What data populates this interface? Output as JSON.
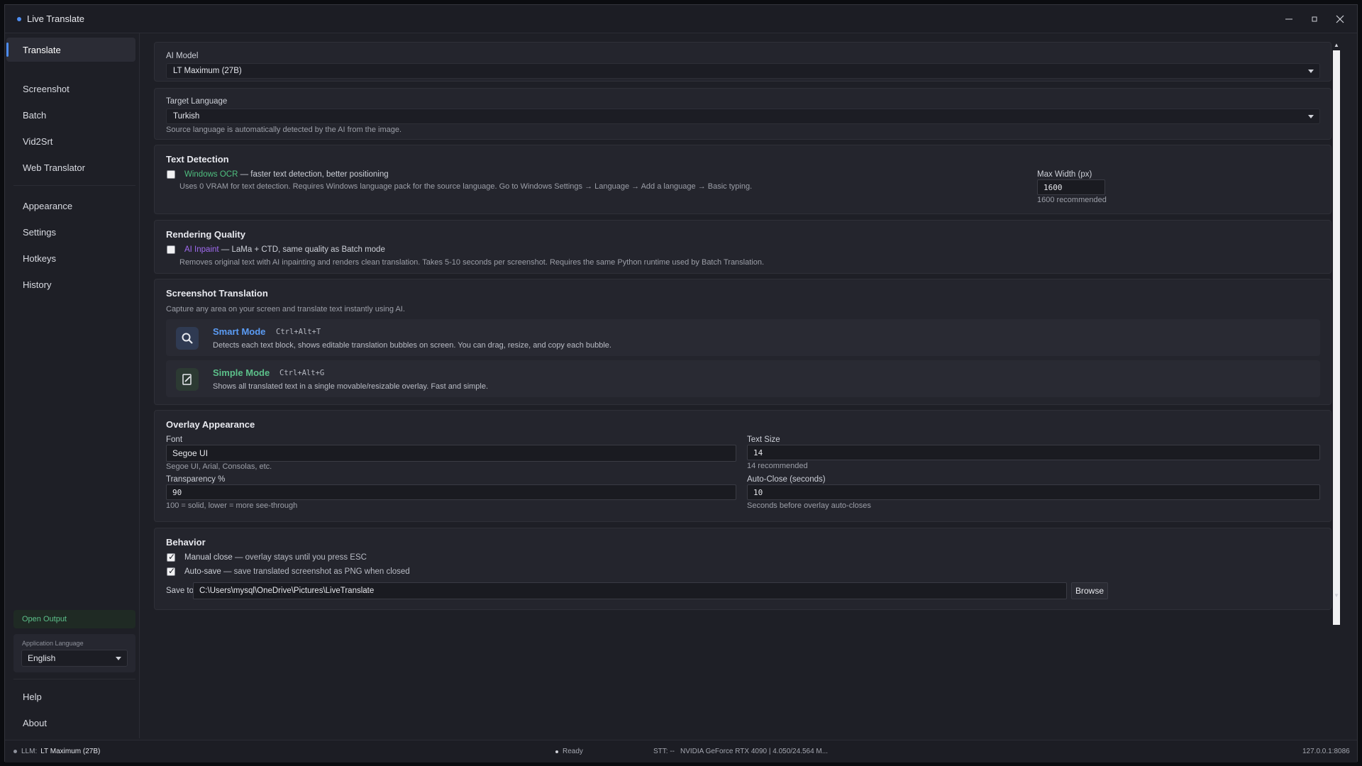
{
  "window": {
    "title": "Live Translate",
    "controls": [
      "—",
      "▫",
      "✕"
    ]
  },
  "sidebar": {
    "items": [
      {
        "label": "Translate"
      },
      {
        "label": "Screenshot"
      },
      {
        "label": "Batch"
      },
      {
        "label": "Vid2Srt"
      },
      {
        "label": "Web Translator"
      },
      {
        "label": "Appearance"
      },
      {
        "label": "Settings"
      },
      {
        "label": "Hotkeys"
      },
      {
        "label": "History"
      }
    ],
    "open_output": "Open Output",
    "app_language_label": "Application Language",
    "app_language_value": "English",
    "bottom_items": [
      {
        "label": "Help"
      },
      {
        "label": "About"
      }
    ]
  },
  "ai_model": {
    "label": "AI Model",
    "value": "LT Maximum (27B)"
  },
  "target_language": {
    "label": "Target Language",
    "value": "Turkish",
    "hint": "Source language is automatically detected by the AI from the image."
  },
  "text_detection": {
    "title": "Text Detection",
    "option_name": "Windows OCR",
    "option_rest": "— faster text detection, better positioning",
    "option_desc": "Uses 0 VRAM for text detection. Requires Windows language pack for the source language. Go to Windows Settings → Language → Add a language → Basic typing.",
    "max_width_label": "Max Width (px)",
    "max_width_value": "1600",
    "max_width_hint": "1600 recommended"
  },
  "rendering_quality": {
    "title": "Rendering Quality",
    "option_name": "AI Inpaint",
    "option_rest": "— LaMa + CTD, same quality as Batch mode",
    "option_desc": "Removes original text with AI inpainting and renders clean translation. Takes 5-10 seconds per screenshot. Requires the same Python runtime used by Batch Translation."
  },
  "screenshot_translation": {
    "title": "Screenshot Translation",
    "subtitle": "Capture any area on your screen and translate text instantly using AI.",
    "smart": {
      "name": "Smart Mode",
      "hotkey": "Ctrl+Alt+T",
      "desc": "Detects each text block, shows editable translation bubbles on screen. You can drag, resize, and copy each bubble."
    },
    "simple": {
      "name": "Simple Mode",
      "hotkey": "Ctrl+Alt+G",
      "desc": "Shows all translated text in a single movable/resizable overlay. Fast and simple."
    }
  },
  "overlay_appearance": {
    "title": "Overlay Appearance",
    "font_label": "Font",
    "font_value": "Segoe UI",
    "font_hint": "Segoe UI, Arial, Consolas, etc.",
    "text_size_label": "Text Size",
    "text_size_value": "14",
    "text_size_hint": "14 recommended",
    "transparency_label": "Transparency %",
    "transparency_value": "90",
    "transparency_hint": "100 = solid, lower = more see-through",
    "auto_close_label": "Auto-Close (seconds)",
    "auto_close_value": "10",
    "auto_close_hint": "Seconds before overlay auto-closes"
  },
  "behavior": {
    "title": "Behavior",
    "manual_close_name": "Manual close",
    "manual_close_rest": "— overlay stays until you press ESC",
    "auto_save_name": "Auto-save",
    "auto_save_rest": "— save translated screenshot as PNG when closed",
    "save_to_label": "Save to",
    "save_to_value": "C:\\Users\\mysql\\OneDrive\\Pictures\\LiveTranslate",
    "browse_label": "Browse"
  },
  "status": {
    "llm_label": "LLM:",
    "llm_value": "LT Maximum (27B)",
    "ready": "Ready",
    "stt": "STT: --",
    "gpu": "NVIDIA GeForce RTX 4090 | 4.050/24.564 M...",
    "address": "127.0.0.1:8086"
  },
  "colors": {
    "accent": "#4d8cf0",
    "ocr_green": "#4fbf7f",
    "inpaint_purple": "#a06af0",
    "smart_blue": "#5b9cf5",
    "simple_green": "#5cc08a"
  }
}
